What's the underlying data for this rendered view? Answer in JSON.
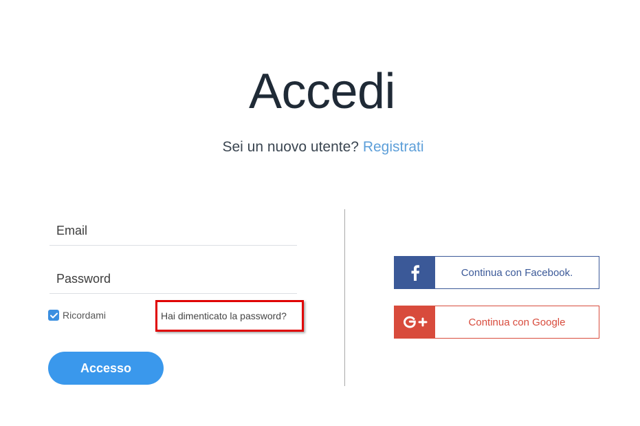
{
  "header": {
    "title": "Accedi",
    "subtitle_prefix": "Sei un nuovo utente?",
    "signup_link": "Registrati"
  },
  "form": {
    "email_placeholder": "Email",
    "password_placeholder": "Password",
    "remember_label": "Ricordami",
    "remember_checked": true,
    "forgot_link": "Hai dimenticato la password?",
    "submit_label": "Accesso"
  },
  "social": {
    "facebook_label": "Continua con Facebook.",
    "google_label": "Continua con Google"
  },
  "colors": {
    "accent": "#3a98ec",
    "link": "#5d9fd9",
    "facebook": "#3b5998",
    "google": "#d84b3c",
    "highlight": "#e00000"
  },
  "icons": {
    "checkbox": "check-icon",
    "facebook": "facebook-icon",
    "google": "google-plus-icon"
  }
}
